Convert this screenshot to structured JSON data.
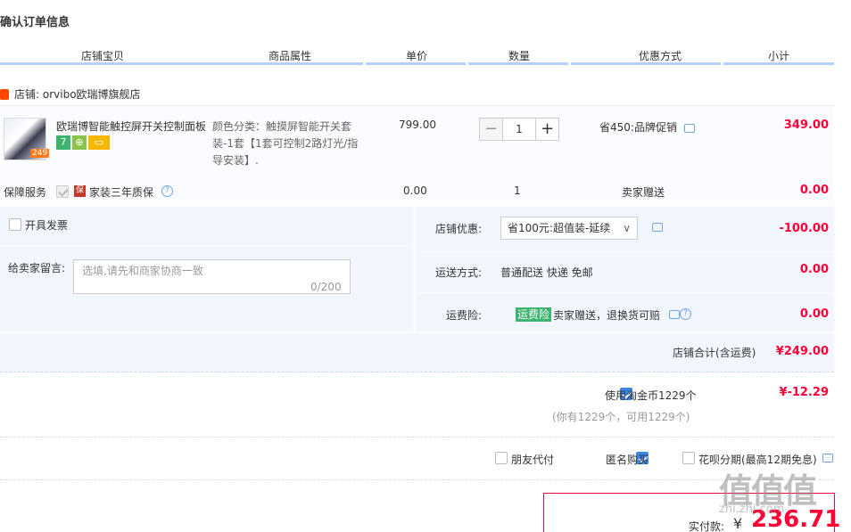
{
  "page": {
    "title": "确认订单信息"
  },
  "columns": [
    "店铺宝贝",
    "商品属性",
    "单价",
    "数量",
    "优惠方式",
    "小计"
  ],
  "store": {
    "label": "店铺",
    "name": "orvibo欧瑞博旗舰店",
    "icon": "shop-icon"
  },
  "item": {
    "name": "欧瑞博智能触控屏开关控制面板",
    "thumb_tag": "249",
    "badges": [
      "7",
      "⊕",
      "▭"
    ],
    "attr_text": "颜色分类：触摸屏智能开关套装-1套【1套可控制2路灯光/指导安装】.",
    "price": "799.00",
    "quantity": "1",
    "promo": "省450:品牌促销",
    "subtotal": "349.00"
  },
  "service": {
    "label": "保障服务",
    "badge": "保",
    "name": "家装三年质保",
    "price": "0.00",
    "qty": "1",
    "promo": "卖家赠送",
    "subtotal": "0.00"
  },
  "invoice": {
    "label": "开具发票"
  },
  "message": {
    "label": "给卖家留言:",
    "placeholder": "选填,请先和商家协商一致",
    "count": "0/200"
  },
  "shop_discount": {
    "label": "店铺优惠:",
    "selected": "省100元:超值装-延续",
    "amount": "-100.00"
  },
  "shipping": {
    "label": "运送方式:",
    "value": "普通配送 快递 免邮",
    "amount": "0.00"
  },
  "insurance": {
    "label": "运费险:",
    "tag": "运费险",
    "desc": "卖家赠送，退换货可赔",
    "amount": "0.00"
  },
  "store_total": {
    "label": "店铺合计(含运费)",
    "amount": "¥249.00"
  },
  "coins": {
    "label": "使用淘金币1229个",
    "amount": "¥-12.29",
    "note": "(你有1229个，可用1229个)"
  },
  "options": {
    "friend_pay": "朋友代付",
    "anonymous": "匿名购买",
    "installment": "花呗分期(最高12期免息)"
  },
  "payment": {
    "label": "实付款:",
    "currency": "¥",
    "amount": "236.71"
  },
  "watermark": {
    "text": "值值值",
    "sub": "zhi.zhi.com"
  },
  "colors": {
    "accent_red": "#ff0036",
    "header_bar": "#b2d1ff",
    "section_bg": "#f2f7ff",
    "check_blue": "#3a85e8"
  }
}
